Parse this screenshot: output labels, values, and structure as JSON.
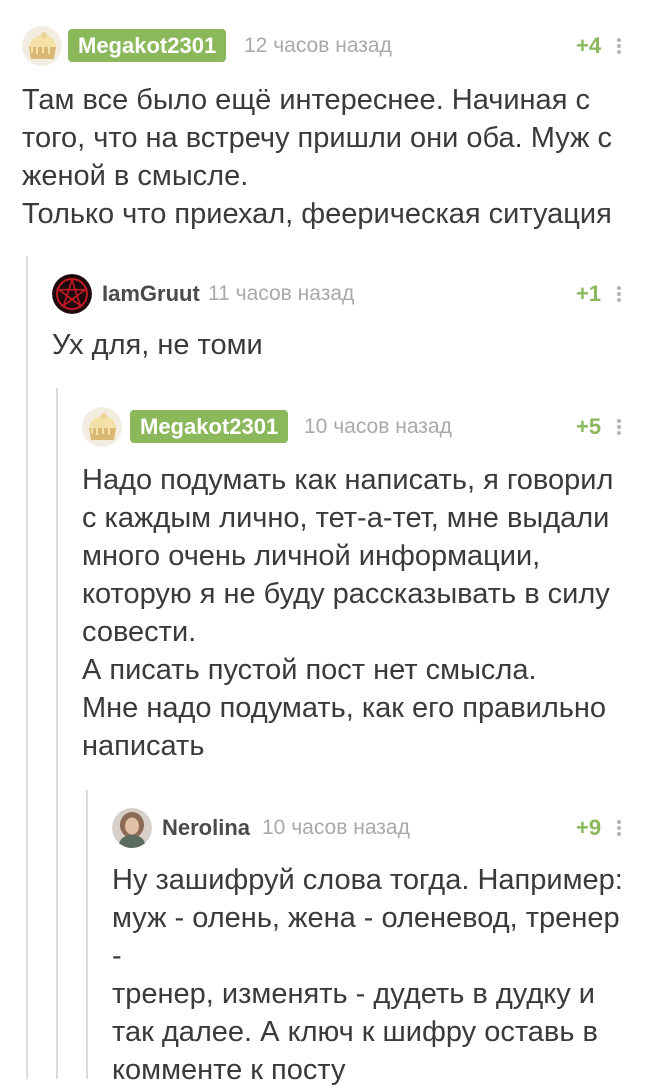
{
  "comments": [
    {
      "author": "Megakot2301",
      "avatar_icon": "cake-icon",
      "time": "12 часов назад",
      "rating": "+4",
      "text": "Там все было ещё интереснее. Начиная с\nтого, что на встречу пришли они оба. Муж с\nженой в смысле.\nТолько что приехал, феерическая ситуация"
    },
    {
      "author": "IamGruut",
      "avatar_icon": "pentagram-icon",
      "time": "11 часов назад",
      "rating": "+1",
      "text": "Ух для, не томи"
    },
    {
      "author": "Megakot2301",
      "avatar_icon": "cake-icon",
      "time": "10 часов назад",
      "rating": "+5",
      "text": "Надо подумать как написать, я говорил\nс каждым лично, тет-а-тет, мне выдали\nмного очень личной информации,\nкоторую я не буду рассказывать в силу\nсовести.\nА писать пустой пост нет смысла.\nМне надо подумать, как его правильно\nнаписать"
    },
    {
      "author": "Nerolina",
      "avatar_icon": "user-photo-icon",
      "time": "10 часов назад",
      "rating": "+9",
      "text": "Ну зашифруй слова тогда. Например:\nмуж - олень, жена - оленевод, тренер -\nтренер, изменять - дудеть в дудку и\nтак далее. А ключ к шифру оставь в\nкомменте к посту"
    }
  ],
  "colors": {
    "author_badge": "#8ab85b",
    "rating": "#8ab85b",
    "time": "#a9a9a9",
    "text": "#3a3a3a",
    "thread_line": "#dcdcdc"
  }
}
